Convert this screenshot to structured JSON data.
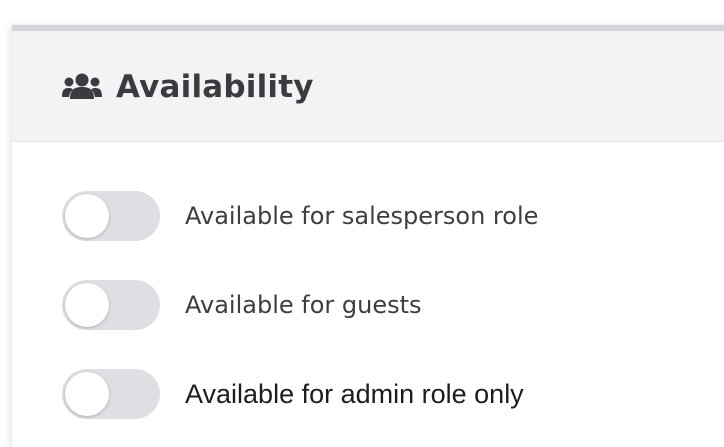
{
  "panel": {
    "title": "Availability",
    "icon": "users-icon"
  },
  "toggles": [
    {
      "label": "Available for salesperson role",
      "checked": false
    },
    {
      "label": "Available for guests",
      "checked": false
    },
    {
      "label": "Available for admin role only",
      "checked": false
    }
  ],
  "colors": {
    "header_background": "#f3f3f5",
    "toggle_off": "#dedfe3",
    "title_text": "#3a3b3e"
  }
}
